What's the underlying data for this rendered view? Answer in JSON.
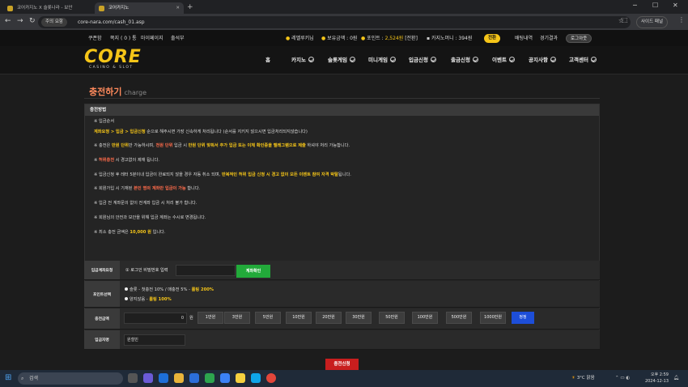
{
  "browser": {
    "tabs": [
      {
        "label": "코어카지노 X 슬롯나라 - 보안"
      },
      {
        "label": "코어카지노"
      }
    ],
    "security_label": "주의 요함",
    "url": "core-nara.com/cash_01.asp",
    "side_panel_label": "사이드 패널",
    "newtab": "+"
  },
  "topbar": {
    "links": [
      "쿠폰함",
      "쪽지 ( 0 ) 통",
      "마이페이지",
      "출석부"
    ],
    "user_level": "레벨루키님",
    "balance_label": "보유금액 : 0원",
    "point_label": "포인트 : ",
    "point_value": "2,524원",
    "point_suffix": " [전환]",
    "casino_money_label": "카지노머니 : 394원",
    "convert_button": "전환",
    "betting_history": "배팅내역",
    "game_results": "경기결과",
    "logout_button": "로그아웃"
  },
  "header": {
    "logo_text": "CORE",
    "logo_sub": "CASINO & SLOT",
    "menu": [
      "홈",
      "카지노",
      "슬롯게임",
      "미니게임",
      "입금신청",
      "출금신청",
      "이벤트",
      "공지사항",
      "고객센터"
    ]
  },
  "page": {
    "title": "충전하기",
    "title_sub": "charge"
  },
  "rules": {
    "header": "충전방법",
    "items": [
      {
        "parts": [
          {
            "t": "※ 입금순서",
            "c": ""
          }
        ]
      },
      {
        "parts": [
          {
            "t": "계좌요청 > 입금 > 입금신청",
            "c": "hl"
          },
          {
            "t": " 순으로 해주시면 가장 신속하게 처리됩니다 (순서를 지키지 않으시면 입금처리되지않습니다)",
            "c": ""
          }
        ]
      },
      {
        "parts": [
          {
            "t": "※ 충전은 ",
            "c": ""
          },
          {
            "t": "만원 단위",
            "c": "hl"
          },
          {
            "t": "만 가능하시며, ",
            "c": ""
          },
          {
            "t": "천원 단위",
            "c": "hlr"
          },
          {
            "t": " 입금 시 ",
            "c": ""
          },
          {
            "t": "만원 단위 맞춰서 추가 입금 또는 이체 확인증을 텔레그램으로 제출",
            "c": "hl"
          },
          {
            "t": " 하셔야 처리 가능합니다.",
            "c": ""
          }
        ]
      },
      {
        "parts": [
          {
            "t": "※ ",
            "c": ""
          },
          {
            "t": "허위충전",
            "c": "hlr"
          },
          {
            "t": " 시 경고없이 제재 됩니다.",
            "c": ""
          }
        ]
      },
      {
        "parts": [
          {
            "t": "※ 입금신청 후 레터 5분이내 입금이 완료되지 않을 경우 자동 취소 되며, ",
            "c": ""
          },
          {
            "t": "반복적인 허위 입금 신청 시 경고 없이 모든 이벤트 참여 자격 박탈",
            "c": "hl"
          },
          {
            "t": "됩니다.",
            "c": ""
          }
        ]
      },
      {
        "parts": [
          {
            "t": "※ 회원가입 시 기재된 ",
            "c": ""
          },
          {
            "t": "본인 명의 계좌만 입금이 가능",
            "c": "hlr"
          },
          {
            "t": " 합니다.",
            "c": ""
          }
        ]
      },
      {
        "parts": [
          {
            "t": "※ 입금 전 계좌문의 없이 전계좌 입금 시 처리 불가 합니다.",
            "c": ""
          }
        ]
      },
      {
        "parts": [
          {
            "t": "※ 회원님의 안전과 보안을 위해 입금 계좌는 수시로 변경됩니다.",
            "c": ""
          }
        ]
      },
      {
        "parts": [
          {
            "t": "※ 최소 충전 금액은 ",
            "c": ""
          },
          {
            "t": "10,000 원",
            "c": "hl"
          },
          {
            "t": " 입니다.",
            "c": ""
          }
        ]
      }
    ]
  },
  "form": {
    "account_label": "입금계좌요청",
    "password_prompt": "① 로그인 비밀번호 입력",
    "account_check_button": "계좌확인",
    "point_label": "포인트선택",
    "option1_text": "슬롯 - 첫충전 10% / 매충전 5% - ",
    "option1_hl": "롤링 200%",
    "option2_text": "양지않음 - ",
    "option2_hl": "롤링 100%",
    "amount_label": "충전금액",
    "amount_value": "0",
    "amount_unit": "원",
    "amount_buttons": [
      "1만원",
      "3만원",
      "5만원",
      "10만원",
      "20만원",
      "30만원",
      "50만원",
      "100만원",
      "500만원",
      "1000만원"
    ],
    "reset_button": "정정",
    "depositor_label": "입금자명",
    "depositor_value": "원철빈",
    "submit_button": "충전신청"
  },
  "taskbar": {
    "search": "검색",
    "weather": "3°C 맑음",
    "clock_time": "오후 2:59",
    "clock_date": "2024-12-13"
  }
}
